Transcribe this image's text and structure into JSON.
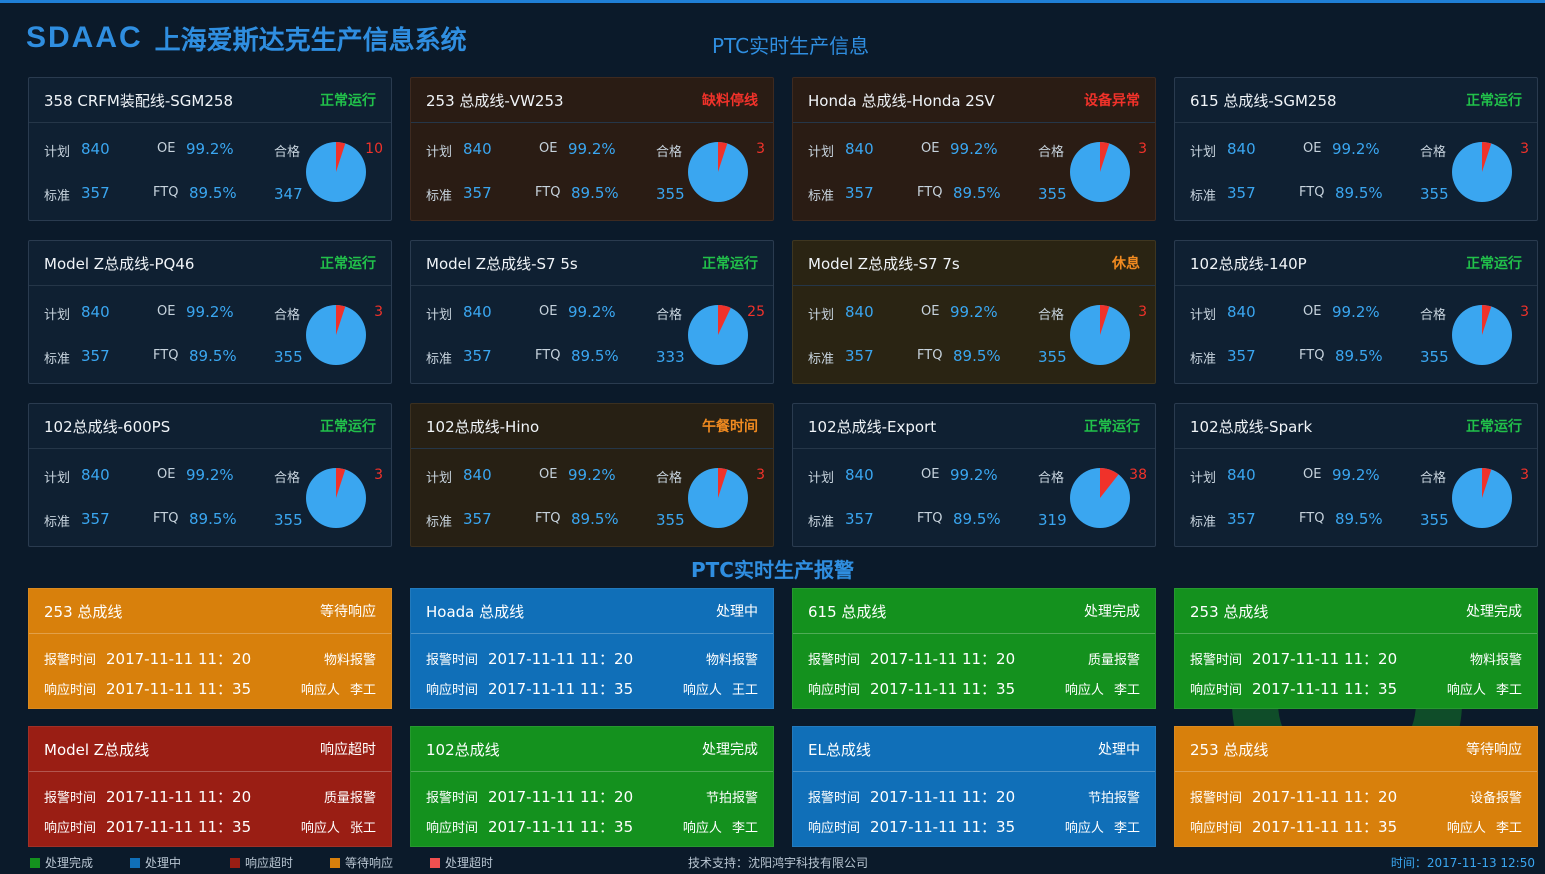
{
  "header": {
    "logo": "SDAAC",
    "title": "上海爱斯达克生产信息系统",
    "subtitle": "PTC实时生产信息"
  },
  "labels": {
    "plan": "计划",
    "oe": "OE",
    "pass": "合格",
    "standard": "标准",
    "ftq": "FTQ",
    "alarm_time": "报警时间",
    "response_time": "响应时间",
    "responder": "响应人"
  },
  "colors": {
    "normal": "#21c04a",
    "fault": "#f0322a",
    "break": "#f08a20",
    "pie_blue": "#3aa6f0",
    "pie_red": "#f0322a"
  },
  "production": [
    {
      "name": "358 CRFM装配线-SGM258",
      "status": "正常运行",
      "plan": "840",
      "oe": "99.2%",
      "standard": "357",
      "ftq": "89.5%",
      "pass": "347",
      "fail": "10",
      "fail_fraction": 0.028
    },
    {
      "name": "253 总成线-VW253",
      "status": "缺料停线",
      "plan": "840",
      "oe": "99.2%",
      "standard": "357",
      "ftq": "89.5%",
      "pass": "355",
      "fail": "3",
      "fail_fraction": 0.008
    },
    {
      "name": "Honda 总成线-Honda 2SV",
      "status": "设备异常",
      "plan": "840",
      "oe": "99.2%",
      "standard": "357",
      "ftq": "89.5%",
      "pass": "355",
      "fail": "3",
      "fail_fraction": 0.008
    },
    {
      "name": "615 总成线-SGM258",
      "status": "正常运行",
      "plan": "840",
      "oe": "99.2%",
      "standard": "357",
      "ftq": "89.5%",
      "pass": "355",
      "fail": "3",
      "fail_fraction": 0.008
    },
    {
      "name": "Model Z总成线-PQ46",
      "status": "正常运行",
      "plan": "840",
      "oe": "99.2%",
      "standard": "357",
      "ftq": "89.5%",
      "pass": "355",
      "fail": "3",
      "fail_fraction": 0.008
    },
    {
      "name": "Model Z总成线-S7 5s",
      "status": "正常运行",
      "plan": "840",
      "oe": "99.2%",
      "standard": "357",
      "ftq": "89.5%",
      "pass": "333",
      "fail": "25",
      "fail_fraction": 0.07
    },
    {
      "name": "Model Z总成线-S7 7s",
      "status": "休息",
      "plan": "840",
      "oe": "99.2%",
      "standard": "357",
      "ftq": "89.5%",
      "pass": "355",
      "fail": "3",
      "fail_fraction": 0.008
    },
    {
      "name": "102总成线-140P",
      "status": "正常运行",
      "plan": "840",
      "oe": "99.2%",
      "standard": "357",
      "ftq": "89.5%",
      "pass": "355",
      "fail": "3",
      "fail_fraction": 0.008
    },
    {
      "name": "102总成线-600PS",
      "status": "正常运行",
      "plan": "840",
      "oe": "99.2%",
      "standard": "357",
      "ftq": "89.5%",
      "pass": "355",
      "fail": "3",
      "fail_fraction": 0.008
    },
    {
      "name": "102总成线-Hino",
      "status": "午餐时间",
      "plan": "840",
      "oe": "99.2%",
      "standard": "357",
      "ftq": "89.5%",
      "pass": "355",
      "fail": "3",
      "fail_fraction": 0.008
    },
    {
      "name": "102总成线-Export",
      "status": "正常运行",
      "plan": "840",
      "oe": "99.2%",
      "standard": "357",
      "ftq": "89.5%",
      "pass": "319",
      "fail": "38",
      "fail_fraction": 0.106
    },
    {
      "name": "102总成线-Spark",
      "status": "正常运行",
      "plan": "840",
      "oe": "99.2%",
      "standard": "357",
      "ftq": "89.5%",
      "pass": "355",
      "fail": "3",
      "fail_fraction": 0.008
    }
  ],
  "alarm_section_title": "PTC实时生产报警",
  "alarms": [
    {
      "line": "253 总成线",
      "status": "等待响应",
      "alarm_time": "2017-11-11 11：20",
      "alarm_type": "物料报警",
      "response_time": "2017-11-11 11：35",
      "responder": "李工",
      "color": "#d8800c"
    },
    {
      "line": "Hoada 总成线",
      "status": "处理中",
      "alarm_time": "2017-11-11 11：20",
      "alarm_type": "物料报警",
      "response_time": "2017-11-11 11：35",
      "responder": "王工",
      "color": "#106fb8"
    },
    {
      "line": "615 总成线",
      "status": "处理完成",
      "alarm_time": "2017-11-11 11：20",
      "alarm_type": "质量报警",
      "response_time": "2017-11-11 11：35",
      "responder": "李工",
      "color": "#14911e"
    },
    {
      "line": "253 总成线",
      "status": "处理完成",
      "alarm_time": "2017-11-11 11：20",
      "alarm_type": "物料报警",
      "response_time": "2017-11-11 11：35",
      "responder": "李工",
      "color": "#14911e"
    },
    {
      "line": "Model Z总成线",
      "status": "响应超时",
      "alarm_time": "2017-11-11 11：20",
      "alarm_type": "质量报警",
      "response_time": "2017-11-11 11：35",
      "responder": "张工",
      "color": "#9a1e14"
    },
    {
      "line": "102总成线",
      "status": "处理完成",
      "alarm_time": "2017-11-11 11：20",
      "alarm_type": "节拍报警",
      "response_time": "2017-11-11 11：35",
      "responder": "李工",
      "color": "#14911e"
    },
    {
      "line": "EL总成线",
      "status": "处理中",
      "alarm_time": "2017-11-11 11：20",
      "alarm_type": "节拍报警",
      "response_time": "2017-11-11 11：35",
      "responder": "李工",
      "color": "#106fb8"
    },
    {
      "line": "253 总成线",
      "status": "等待响应",
      "alarm_time": "2017-11-11 11：20",
      "alarm_type": "设备报警",
      "response_time": "2017-11-11 11：35",
      "responder": "李工",
      "color": "#d8800c"
    }
  ],
  "footer": {
    "legend": [
      {
        "label": "处理完成",
        "color": "#14911e"
      },
      {
        "label": "处理中",
        "color": "#106fb8"
      },
      {
        "label": "响应超时",
        "color": "#9a1e14"
      },
      {
        "label": "等待响应",
        "color": "#d8800c"
      },
      {
        "label": "处理超时",
        "color": "#f05050"
      }
    ],
    "support": "技术支持：沈阳鸿宇科技有限公司",
    "time": "时间：2017-11-13 12:50"
  }
}
